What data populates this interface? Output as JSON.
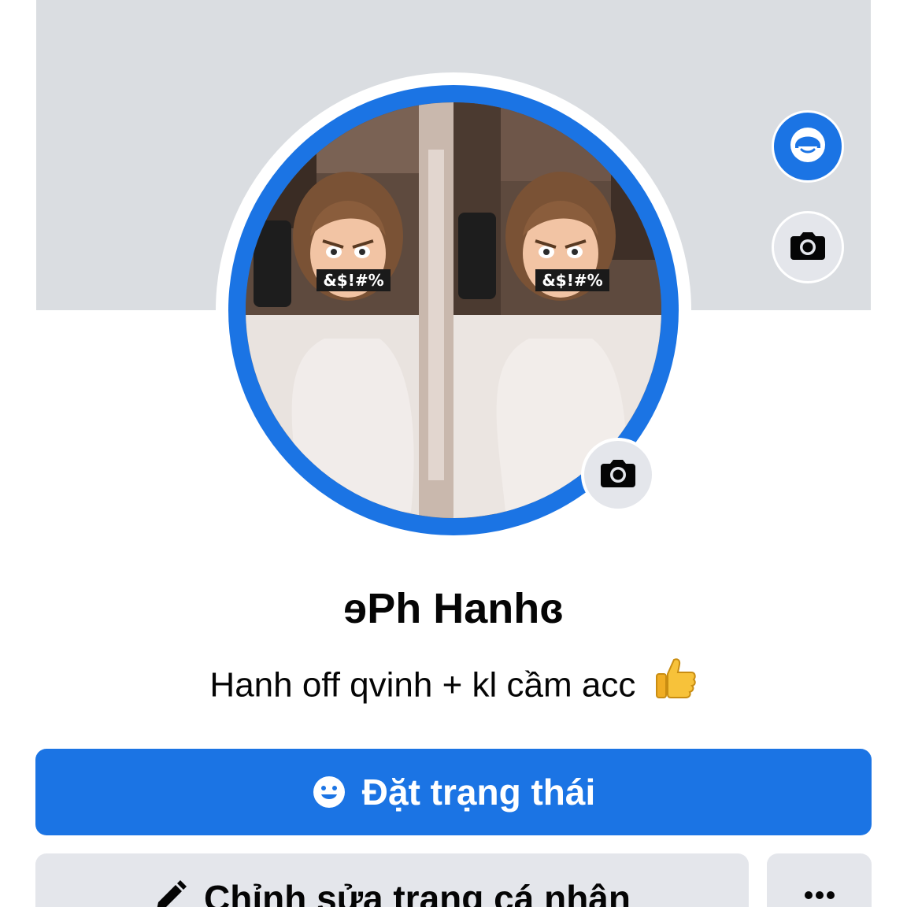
{
  "profile": {
    "name": "ɘPh Hanhɞ",
    "bio": "Hanh off qvinh + kl cầm acc",
    "bio_emoji": "thumbs-up",
    "avatar_caption": "&$!#%"
  },
  "actions": {
    "primary_label": "Đặt trạng thái",
    "edit_label": "Chỉnh sửa trang cá nhân",
    "more_label": "•••"
  },
  "icons": {
    "avatar_style": "avatar-face-icon",
    "cover_camera": "camera-icon",
    "avatar_camera": "camera-icon",
    "status": "smile-icon",
    "edit": "pencil-icon",
    "more": "more-dots-icon"
  },
  "colors": {
    "brand_blue": "#1b74e4",
    "cover_gray": "#dadde1",
    "button_gray": "#e4e6eb",
    "text": "#050505"
  }
}
